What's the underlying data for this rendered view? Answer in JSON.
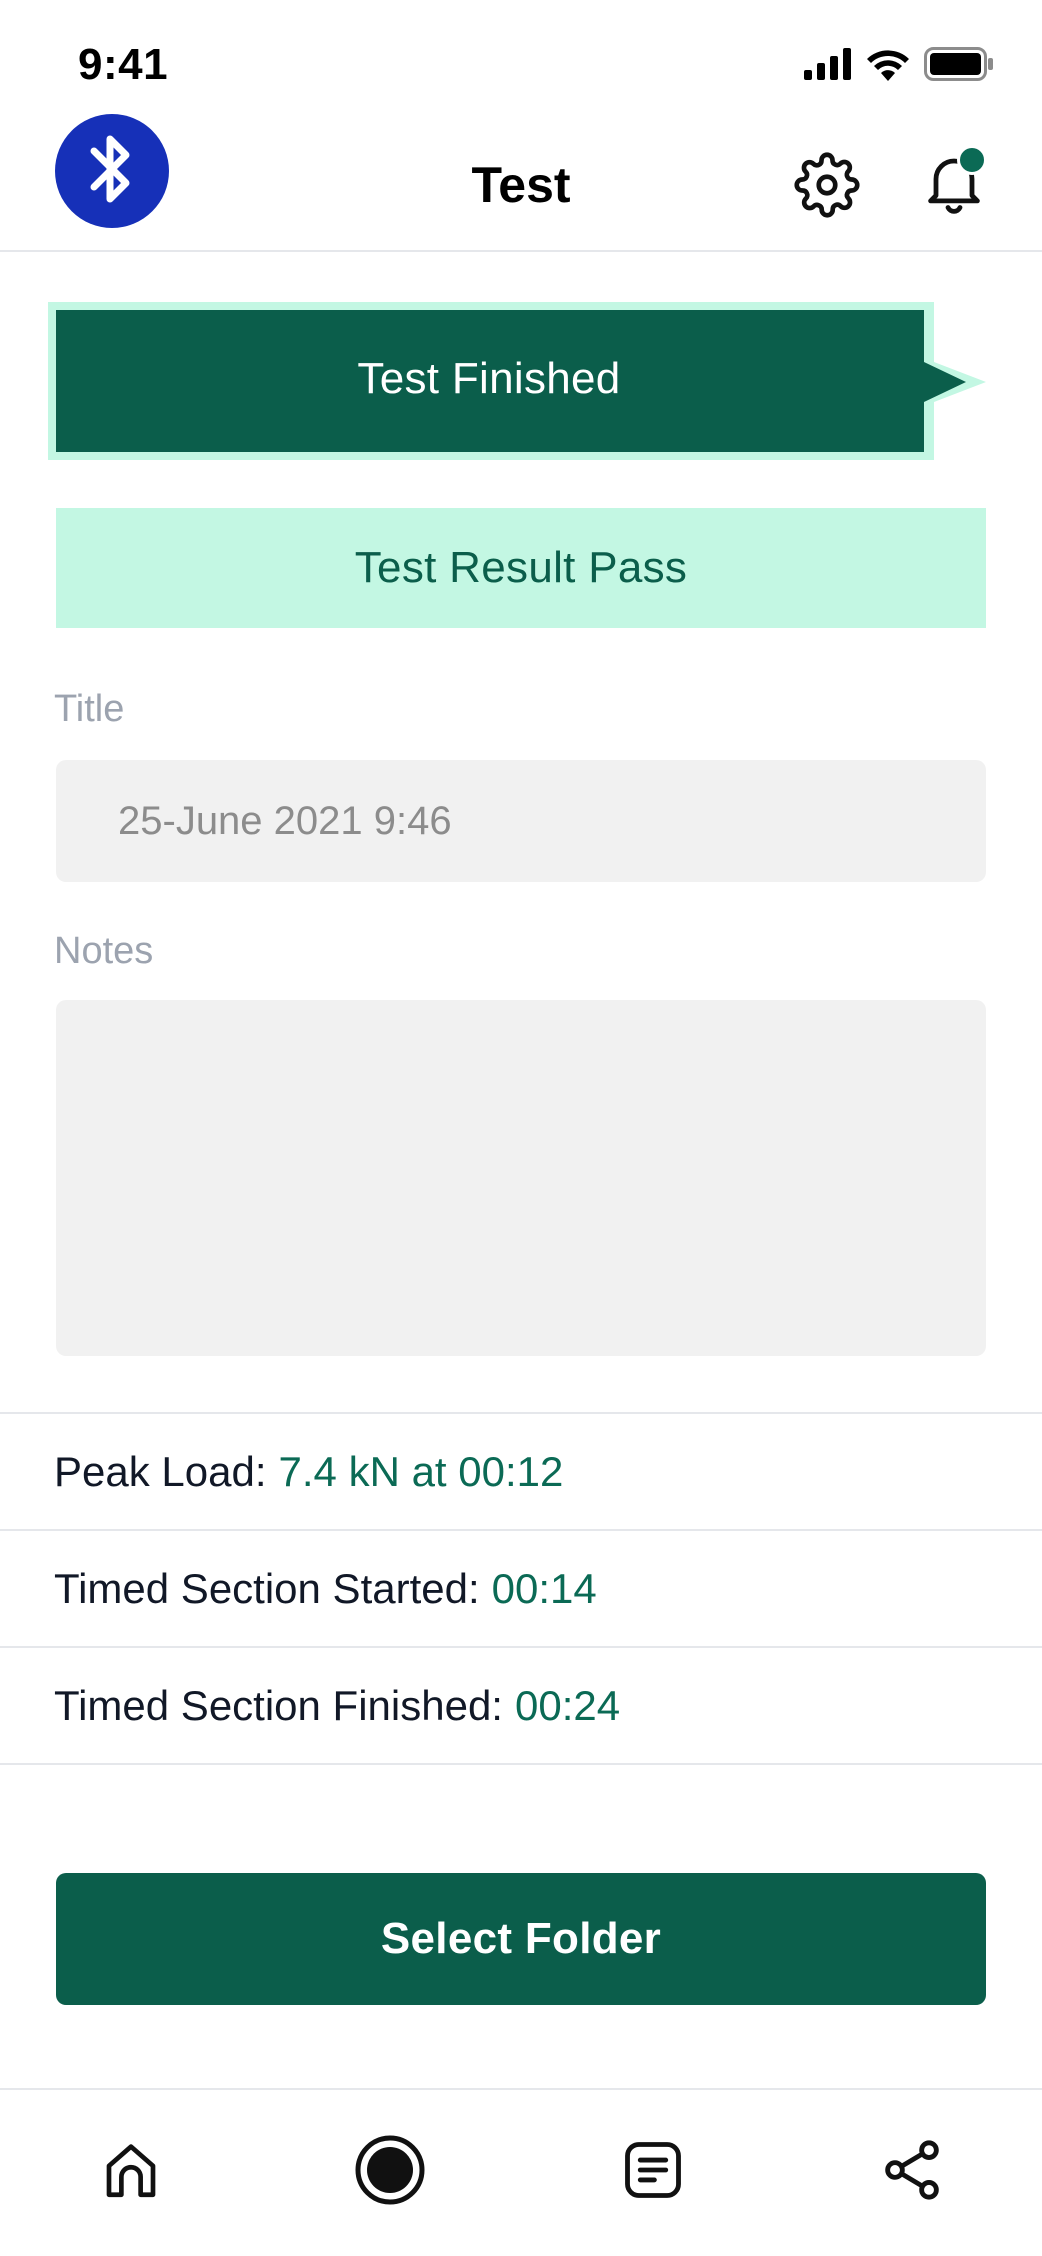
{
  "status_bar": {
    "time": "9:41",
    "icons": [
      "cellular-signal-icon",
      "wifi-icon",
      "battery-icon"
    ]
  },
  "header": {
    "title": "Test",
    "left_icon": "bluetooth-icon",
    "right_icons": [
      "gear-icon",
      "bell-icon"
    ],
    "notification_dot": true
  },
  "banners": {
    "status": "Test Finished",
    "result": "Test Result Pass"
  },
  "form": {
    "title_label": "Title",
    "title_value": "25-June 2021 9:46",
    "notes_label": "Notes",
    "notes_value": ""
  },
  "info": [
    {
      "label": "Peak Load:",
      "value": "7.4 kN at 00:12"
    },
    {
      "label": "Timed Section Started:",
      "value": "00:14"
    },
    {
      "label": "Timed Section Finished:",
      "value": "00:24"
    }
  ],
  "actions": {
    "select_folder": "Select Folder"
  },
  "tab_bar": {
    "tabs": [
      "home-icon",
      "record-icon",
      "notes-icon",
      "share-icon"
    ],
    "active": "record-icon"
  },
  "colors": {
    "brand_green": "#0b5e4b",
    "accent_mint": "#c3f7e3",
    "bluetooth_blue": "#1630b8",
    "input_bg": "#f1f1f1"
  }
}
